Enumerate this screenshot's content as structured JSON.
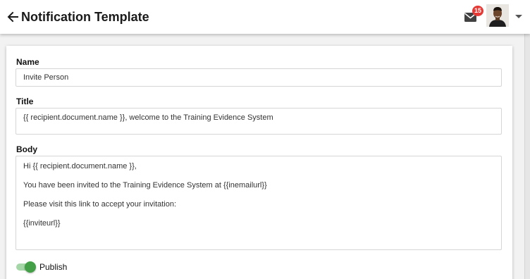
{
  "header": {
    "title": "Notification Template",
    "back_icon": "arrow-left-icon",
    "mail_icon": "mail-icon",
    "mail_count": "15",
    "badge_color": "#e53935",
    "caret_icon": "caret-down-icon"
  },
  "form": {
    "name_label": "Name",
    "name_value": "Invite Person",
    "title_label": "Title",
    "title_value": "{{ recipient.document.name }}, welcome to the Training Evidence System",
    "body_label": "Body",
    "body_lines": [
      "Hi {{ recipient.document.name }},",
      "You have been invited to the Training Evidence System at {{inemailurl}}",
      "Please visit this link to accept your invitation:",
      "{{inviteurl}}"
    ],
    "publish_label": "Publish",
    "publish_on": true,
    "toggle_color": "#43a047"
  }
}
